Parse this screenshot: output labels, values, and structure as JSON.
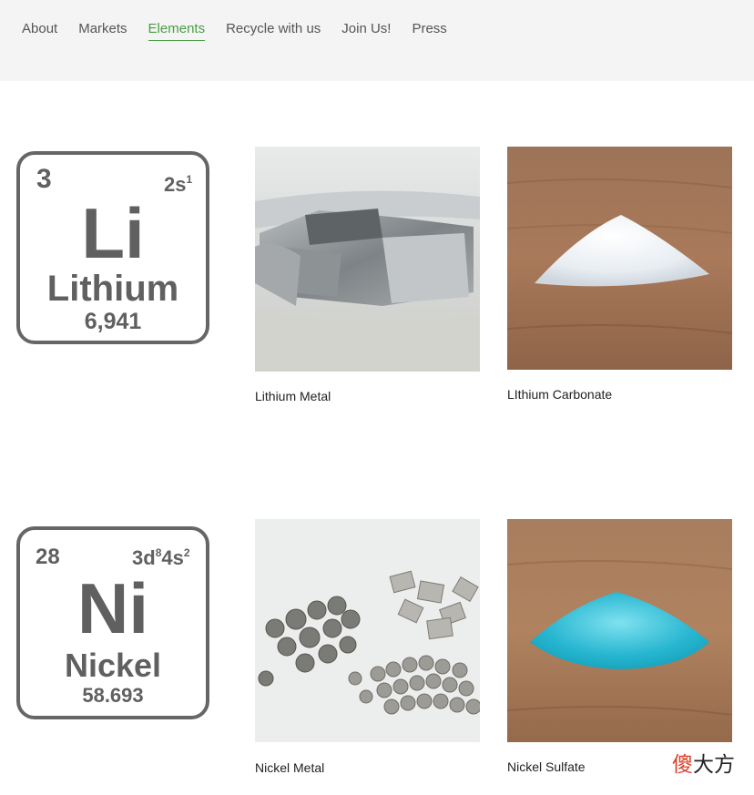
{
  "nav": {
    "items": [
      {
        "label": "About"
      },
      {
        "label": "Markets"
      },
      {
        "label": "Elements",
        "active": true
      },
      {
        "label": "Recycle with us"
      },
      {
        "label": "Join Us!"
      },
      {
        "label": "Press"
      }
    ],
    "active_color": "#4a9d45"
  },
  "elements": [
    {
      "tile": {
        "atomic_number": "3",
        "config_base": "2s",
        "config_sup": "1",
        "symbol": "Li",
        "name": "Lithium",
        "mass": "6,941"
      },
      "products": [
        {
          "caption": "Lithium Metal",
          "image": "lithium-metal-photo"
        },
        {
          "caption": "LIthium Carbonate",
          "image": "lithium-carbonate-photo"
        }
      ]
    },
    {
      "tile": {
        "atomic_number": "28",
        "config_a": "3d",
        "config_a_sup": "8",
        "config_b": "4s",
        "config_b_sup": "2",
        "symbol": "Ni",
        "name": "Nickel",
        "mass": "58.693"
      },
      "products": [
        {
          "caption": "Nickel Metal",
          "image": "nickel-metal-photo"
        },
        {
          "caption": "Nickel Sulfate",
          "image": "nickel-sulfate-photo"
        }
      ]
    }
  ],
  "watermark": {
    "first": "傻",
    "rest": "大方"
  }
}
